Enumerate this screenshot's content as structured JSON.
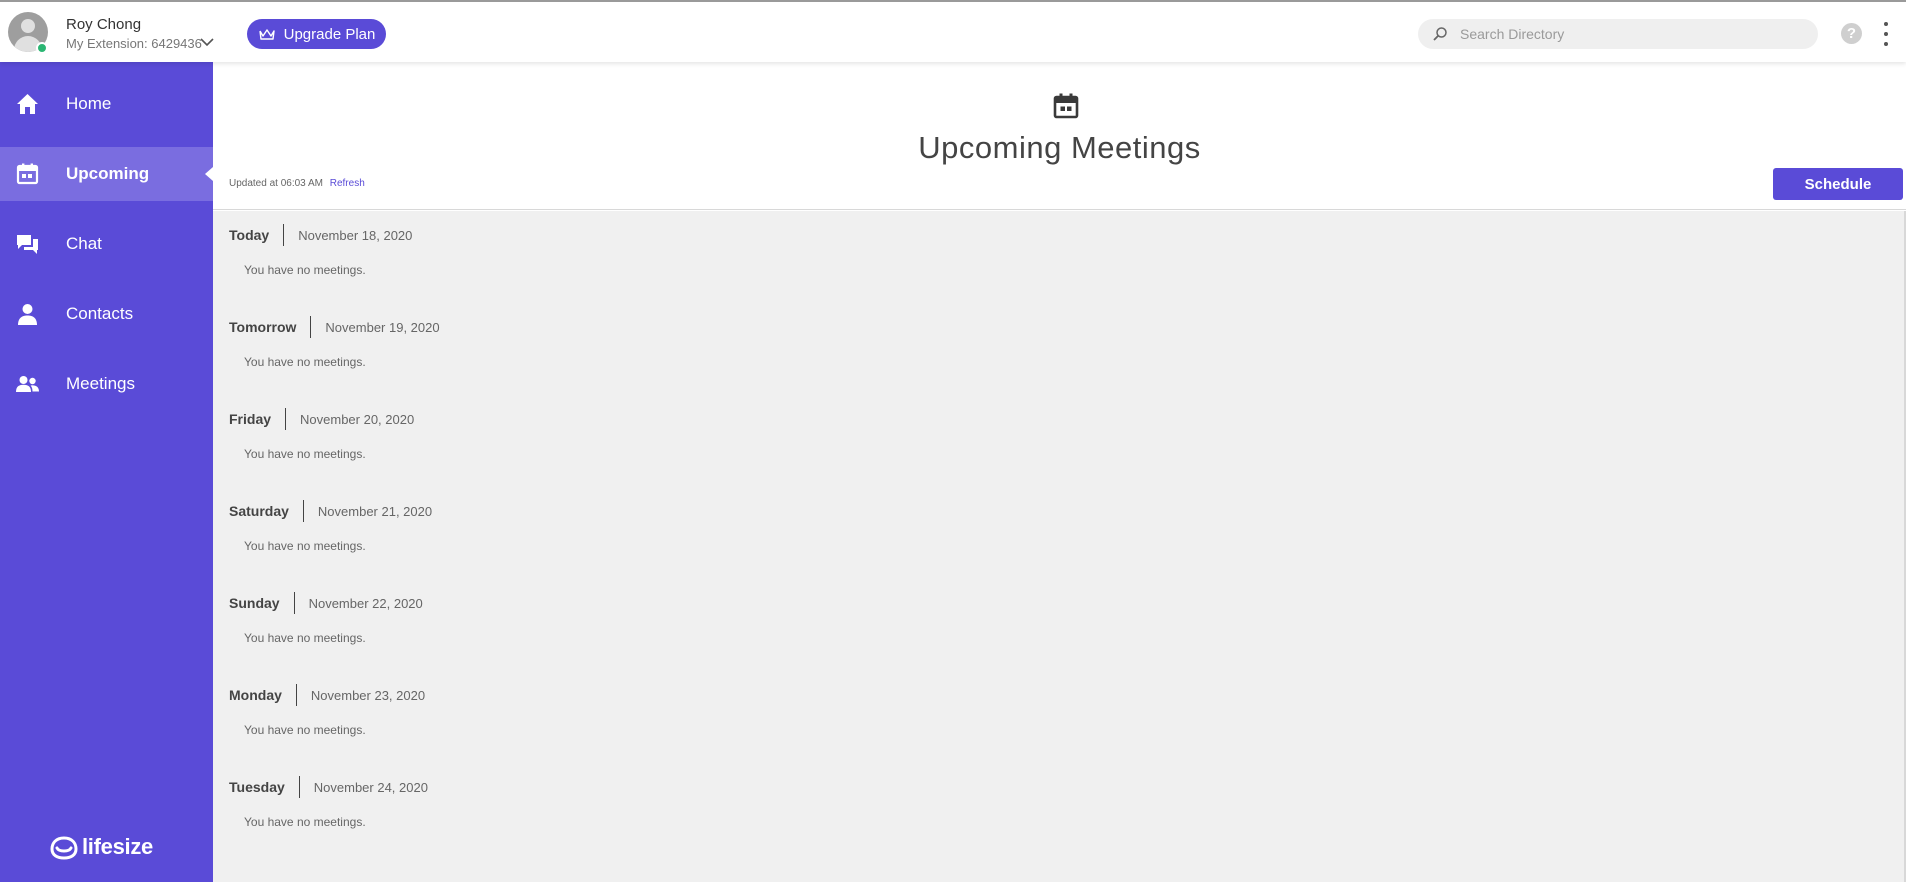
{
  "header": {
    "user_name": "Roy Chong",
    "extension": "My Extension: 6429436",
    "upgrade_label": "Upgrade Plan",
    "search_placeholder": "Search Directory",
    "help_glyph": "?",
    "presence_color": "#2bb673"
  },
  "sidebar": {
    "items": [
      {
        "label": "Home",
        "icon": "home-icon",
        "active": false
      },
      {
        "label": "Upcoming",
        "icon": "calendar-icon",
        "active": true
      },
      {
        "label": "Chat",
        "icon": "chat-icon",
        "active": false
      },
      {
        "label": "Contacts",
        "icon": "person-icon",
        "active": false
      },
      {
        "label": "Meetings",
        "icon": "people-icon",
        "active": false
      }
    ],
    "logo_text": "lifesize"
  },
  "main": {
    "title": "Upcoming Meetings",
    "updated_text": "Updated at 06:03 AM",
    "refresh_label": "Refresh",
    "schedule_label": "Schedule",
    "days": [
      {
        "day": "Today",
        "date": "November 18, 2020",
        "message": "You have no meetings."
      },
      {
        "day": "Tomorrow",
        "date": "November 19, 2020",
        "message": "You have no meetings."
      },
      {
        "day": "Friday",
        "date": "November 20, 2020",
        "message": "You have no meetings."
      },
      {
        "day": "Saturday",
        "date": "November 21, 2020",
        "message": "You have no meetings."
      },
      {
        "day": "Sunday",
        "date": "November 22, 2020",
        "message": "You have no meetings."
      },
      {
        "day": "Monday",
        "date": "November 23, 2020",
        "message": "You have no meetings."
      },
      {
        "day": "Tuesday",
        "date": "November 24, 2020",
        "message": "You have no meetings."
      }
    ]
  },
  "colors": {
    "brand": "#5a4bd7",
    "sidebar_active": "#7a6de0",
    "list_background": "#f0f0f0"
  }
}
